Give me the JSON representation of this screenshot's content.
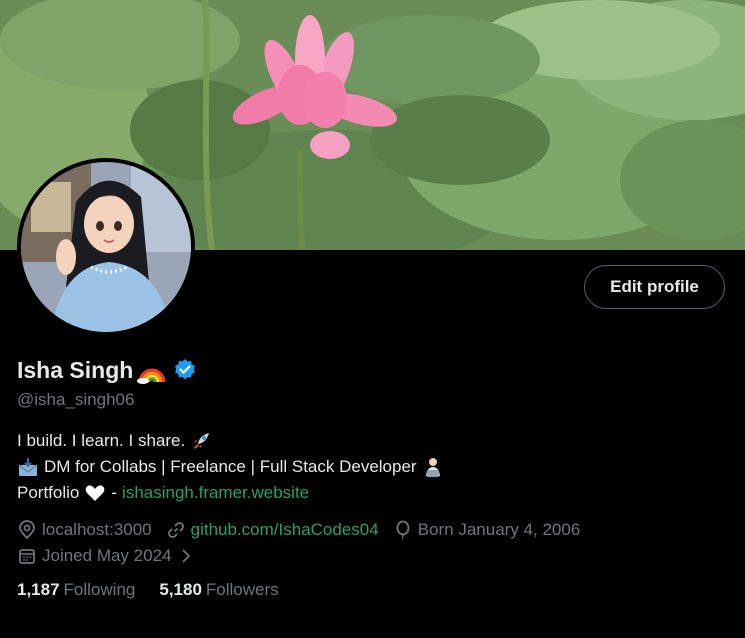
{
  "profile": {
    "name": "Isha Singh",
    "handle": "@isha_singh06",
    "edit_label": "Edit profile"
  },
  "bio": {
    "line1": "I build. I learn. I share.",
    "line2": "DM for Collabs | Freelance | Full Stack Developer",
    "line3_prefix": "Portfolio",
    "line3_dash": "-",
    "portfolio_link": "ishasingh.framer.website"
  },
  "meta": {
    "location": "localhost:3000",
    "website": "github.com/IshaCodes04",
    "birthday": "Born January 4, 2006",
    "joined": "Joined May 2024"
  },
  "stats": {
    "following_count": "1,187",
    "following_label": "Following",
    "followers_count": "5,180",
    "followers_label": "Followers"
  },
  "colors": {
    "background": "#000000",
    "text": "#e7e9ea",
    "muted": "#71767b",
    "link": "#27a06b",
    "verified": "#1d9bf0"
  },
  "icons": [
    "rainbow-icon",
    "verified-icon",
    "rocket-icon",
    "inbox-icon",
    "developer-icon",
    "heart-icon",
    "location-icon",
    "link-icon",
    "balloon-icon",
    "calendar-icon",
    "chevron-right-icon"
  ]
}
